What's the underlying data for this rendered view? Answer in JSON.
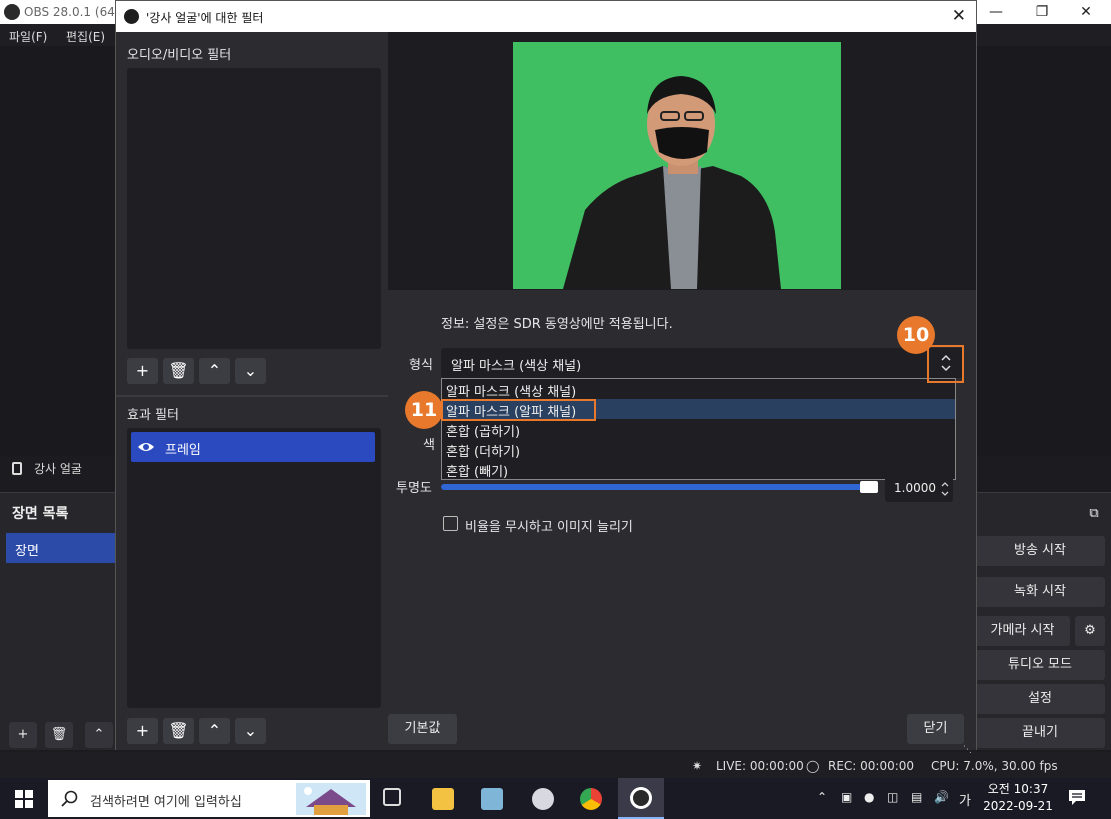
{
  "obs_window": {
    "title": "OBS 28.0.1 (64-",
    "menu": [
      "파일(F)",
      "편집(E)"
    ],
    "source_name": "강사 얼굴",
    "scene_list_title": "장면 목록",
    "scenes": [
      "장면"
    ],
    "controls": {
      "stream": "방송 시작",
      "record": "녹화 시작",
      "camera": "가메라 시작",
      "studio": "튜디오 모드",
      "settings": "설정",
      "exit": "끝내기"
    },
    "status": {
      "live": "LIVE: 00:00:00",
      "rec": "REC: 00:00:00",
      "cpu": "CPU: 7.0%, 30.00 fps"
    }
  },
  "dialog": {
    "title": "'강사 얼굴'에 대한 필터",
    "av_filters_label": "오디오/비디오 필터",
    "effect_filters_label": "효과 필터",
    "effect_filters": [
      {
        "name": "프레임"
      }
    ],
    "info": "정보: 설정은 SDR 동영상에만 적용됩니다.",
    "type_label": "형식",
    "type_value": "알파 마스크 (색상 채널)",
    "type_options": [
      "알파 마스크 (색상 채널)",
      "알파 마스크 (알파 채널)",
      "혼합 (곱하기)",
      "혼합 (더하기)",
      "혼합 (빼기)"
    ],
    "highlighted_option": 1,
    "color_label": "색",
    "opacity_label": "투명도",
    "opacity_value": "1.0000",
    "opacity_fraction": 1.0,
    "stretch_label": "비율을 무시하고 이미지 늘리기",
    "stretch_checked": false,
    "defaults_button": "기본값",
    "close_button": "닫기"
  },
  "annotations": {
    "step_10": "10",
    "step_11": "11"
  },
  "taskbar": {
    "search_placeholder": "검색하려면 여기에 입력하십",
    "ime": "가",
    "time": "오전 10:37",
    "date": "2022-09-21"
  },
  "colors": {
    "accent": "#2c4ac0",
    "callout": "#e8792c",
    "chroma_green": "#3fbf62"
  }
}
